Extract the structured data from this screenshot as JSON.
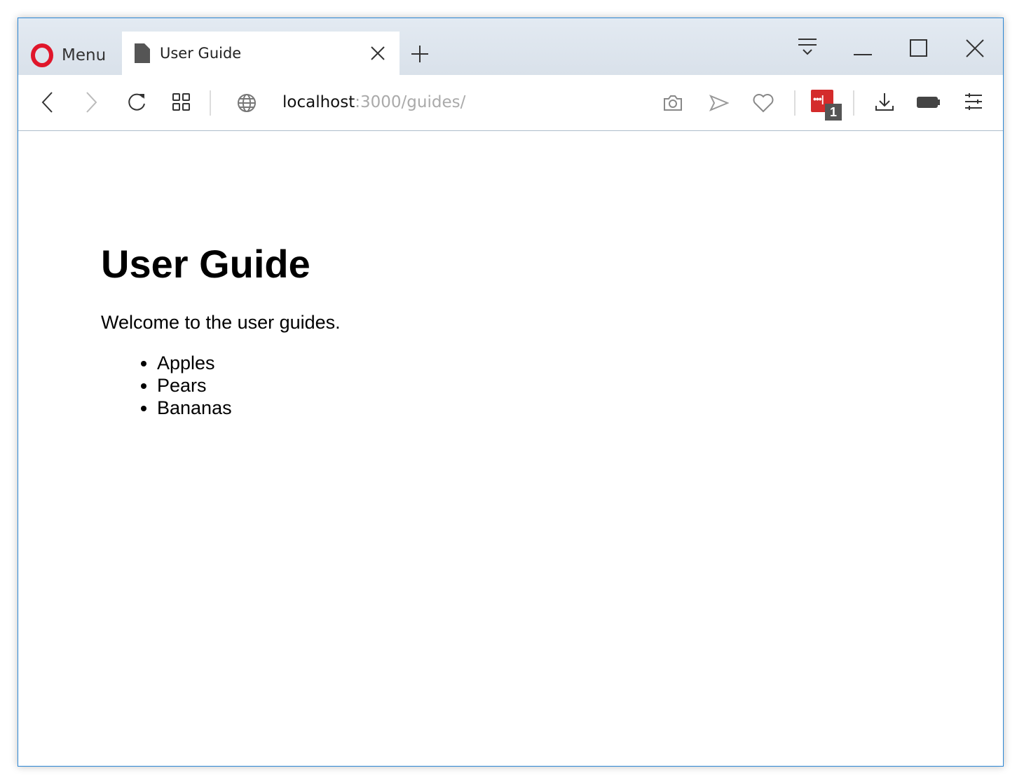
{
  "browser": {
    "menu_label": "Menu",
    "tab_title": "User Guide",
    "url_host": "localhost",
    "url_rest": ":3000/guides/",
    "badge_count": "1"
  },
  "page": {
    "heading": "User Guide",
    "intro": "Welcome to the user guides.",
    "items": [
      "Apples",
      "Pears",
      "Bananas"
    ]
  },
  "colors": {
    "opera_red": "#e0162b",
    "extension_red": "#d42b2b",
    "window_border": "#2b86d4"
  }
}
